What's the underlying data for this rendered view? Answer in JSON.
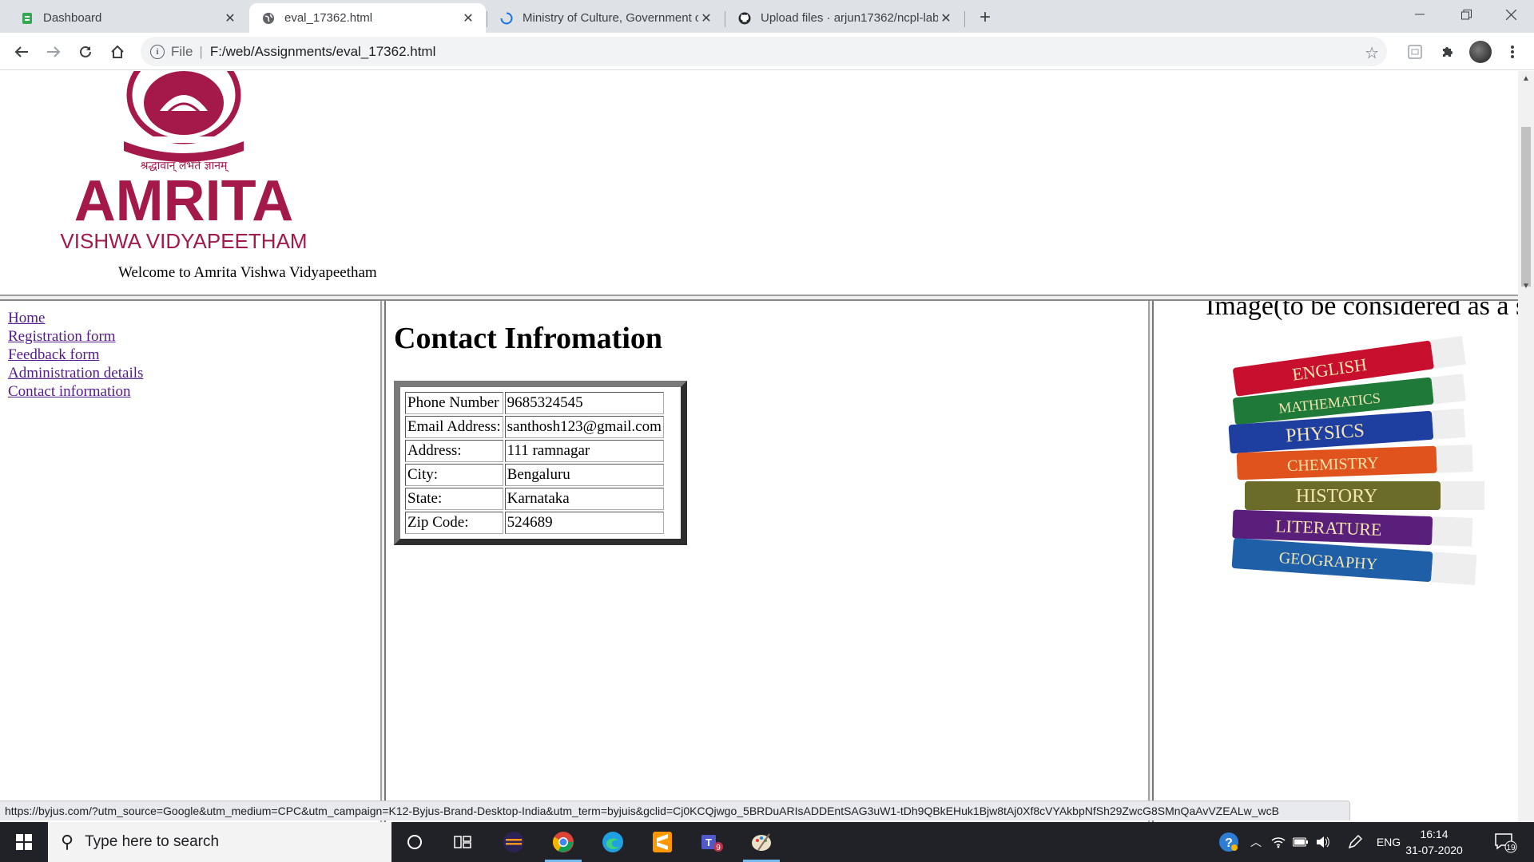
{
  "browser": {
    "tabs": [
      {
        "label": "Dashboard",
        "icon": "document-icon"
      },
      {
        "label": "eval_17362.html",
        "icon": "globe-icon"
      },
      {
        "label": "Ministry of Culture, Government of India",
        "icon": "loading-icon"
      },
      {
        "label": "Upload files · arjun17362/ncpl-lab",
        "icon": "github-icon"
      }
    ],
    "address": {
      "scheme_label": "File",
      "url": "F:/web/Assignments/eval_17362.html"
    }
  },
  "page": {
    "header": {
      "logo_motto": "श्रद्धावान् लभते ज्ञानम्",
      "logo_title": "AMRITA",
      "logo_subtitle": "VISHWA VIDYAPEETHAM",
      "welcome": "Welcome to Amrita Vishwa Vidyapeetham"
    },
    "nav": [
      {
        "label": "Home"
      },
      {
        "label": "Registration form"
      },
      {
        "label": "Feedback form"
      },
      {
        "label": "Administration details"
      },
      {
        "label": "Contact information"
      }
    ],
    "main": {
      "title": "Contact Infromation",
      "rows": [
        {
          "label": "Phone Number",
          "value": "9685324545"
        },
        {
          "label": "Email Address:",
          "value": "santhosh123@gmail.com"
        },
        {
          "label": "Address:",
          "value": "111 ramnagar"
        },
        {
          "label": "City:",
          "value": "Bengaluru"
        },
        {
          "label": "State:",
          "value": "Karnataka"
        },
        {
          "label": "Zip Code:",
          "value": "524689"
        }
      ]
    },
    "side": {
      "caption": "Image(to be considered as a si",
      "books": [
        "ENGLISH",
        "MATHEMATICS",
        "PHYSICS",
        "CHEMISTRY",
        "HISTORY",
        "LITERATURE",
        "GEOGRAPHY"
      ]
    }
  },
  "status_url": "https://byjus.com/?utm_source=Google&utm_medium=CPC&utm_campaign=K12-Byjus-Brand-Desktop-India&utm_term=byjuis&gclid=Cj0KCQjwgo_5BRDuARIsADDEntSAG3uW1-tDh9QBkEHuk1Bjw8tAj0Xf8cVYAkbpNfSh29ZwcG8SMnQaAvVZEALw_wcB",
  "taskbar": {
    "search_placeholder": "Type here to search",
    "language": "ENG",
    "time": "16:14",
    "date": "31-07-2020",
    "notification_count": "19",
    "teams_badge": "9"
  },
  "colors": {
    "amrita_maroon": "#a4184a",
    "link_visited": "#551a8b",
    "tab_strip": "#dee1e6",
    "taskbar": "#202227"
  }
}
